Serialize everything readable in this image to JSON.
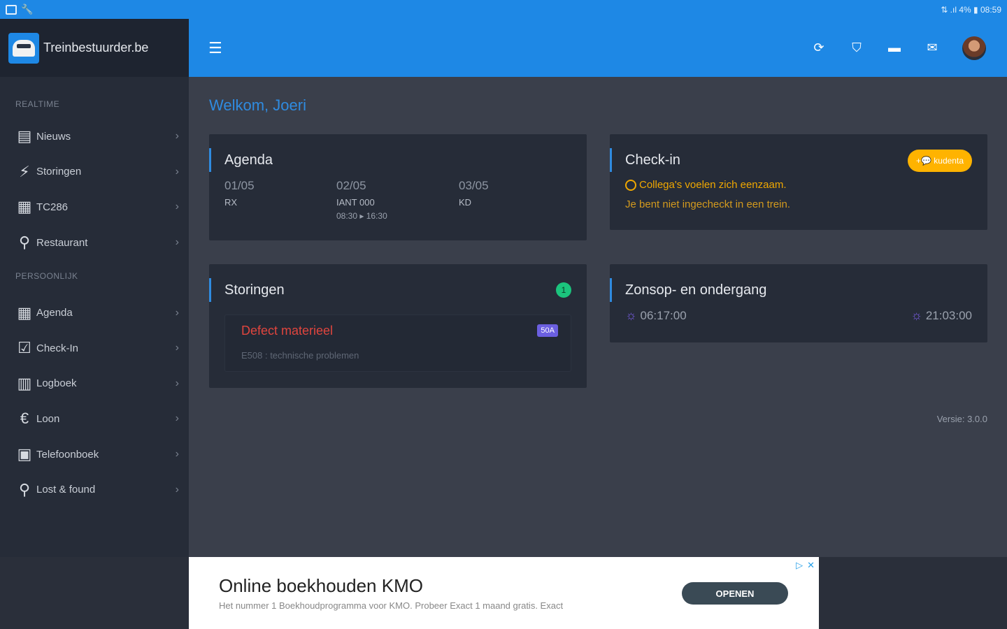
{
  "statusbar": {
    "right": "⇅ .ıl 4% ▮ 08:59"
  },
  "app": {
    "name": "Treinbestuurder.be"
  },
  "sidebar": {
    "sections": [
      "REALTIME",
      "PERSOONLIJK"
    ],
    "realtime": [
      {
        "label": "Nieuws",
        "icon": "newspaper-icon",
        "glyph": "▤"
      },
      {
        "label": "Storingen",
        "icon": "bolt-icon",
        "glyph": "⚡"
      },
      {
        "label": "TC286",
        "icon": "calculator-icon",
        "glyph": "▦"
      },
      {
        "label": "Restaurant",
        "icon": "fork-knife-icon",
        "glyph": "⚲"
      }
    ],
    "persoonlijk": [
      {
        "label": "Agenda",
        "icon": "calendar-icon",
        "glyph": "▦"
      },
      {
        "label": "Check-In",
        "icon": "checkbox-icon",
        "glyph": "☑"
      },
      {
        "label": "Logboek",
        "icon": "book-icon",
        "glyph": "▥"
      },
      {
        "label": "Loon",
        "icon": "euro-icon",
        "glyph": "€"
      },
      {
        "label": "Telefoonboek",
        "icon": "contacts-icon",
        "glyph": "▣"
      },
      {
        "label": "Lost & found",
        "icon": "magnifier-icon",
        "glyph": "⚲"
      }
    ]
  },
  "main": {
    "welcome": "Welkom, Joeri",
    "agenda": {
      "title": "Agenda",
      "days": [
        {
          "date": "01/05",
          "code": "RX",
          "time": ""
        },
        {
          "date": "02/05",
          "code": "IANT 000",
          "time": "08:30 ▸ 16:30"
        },
        {
          "date": "03/05",
          "code": "KD",
          "time": ""
        }
      ]
    },
    "checkin": {
      "title": "Check-in",
      "pill": "+💬 kudenta",
      "line1": "Collega's voelen zich eenzaam.",
      "line2": "Je bent niet ingecheckt in een trein."
    },
    "storingen": {
      "title": "Storingen",
      "count": "1",
      "item_title": "Defect materieel",
      "item_badge": "50A",
      "item_desc": "E508 : technische problemen"
    },
    "zon": {
      "title": "Zonsop- en ondergang",
      "sunrise": "06:17:00",
      "sunset": "21:03:00"
    },
    "version": "Versie: 3.0.0"
  },
  "ad": {
    "title": "Online boekhouden KMO",
    "subtitle": "Het nummer 1 Boekhoudprogramma voor KMO. Probeer Exact 1 maand gratis. Exact",
    "button": "OPENEN"
  },
  "colors": {
    "accent": "#1e88e5",
    "sidebar": "#262c38",
    "warning": "#ffb300",
    "error": "#e0453e",
    "success": "#1bc47d"
  }
}
